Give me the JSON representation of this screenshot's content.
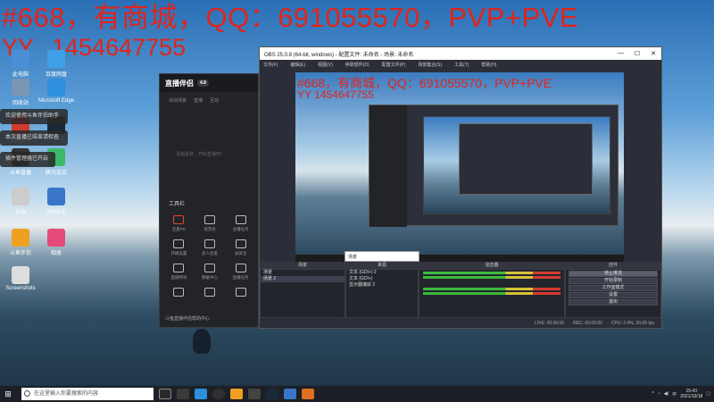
{
  "overlay": {
    "line1": "#668，有商城，QQ：691055570，PVP+PVE",
    "line2_prefix": "YY",
    "line2_number": "1454647755"
  },
  "desktop_icons": [
    {
      "label": "此电脑",
      "color": "#4a8fd8"
    },
    {
      "label": "百度网盘",
      "color": "#3fa0e8"
    },
    {
      "label": "回收站",
      "color": "#7b95b5"
    },
    {
      "label": "Microsoft Edge",
      "color": "#2e8ee0"
    },
    {
      "label": "火绒安全",
      "color": "#d03b2e"
    },
    {
      "label": "Steam",
      "color": "#1b2838"
    },
    {
      "label": "斗鱼直播",
      "color": "#333"
    },
    {
      "label": "腾讯会议",
      "color": "#3db86b"
    },
    {
      "label": "文档",
      "color": "#ccc"
    },
    {
      "label": "360安全",
      "color": "#3a76c8"
    },
    {
      "label": "斗鱼伴侣",
      "color": "#f0a020"
    },
    {
      "label": "相册",
      "color": "#e64a7a"
    },
    {
      "label": "Screenshots",
      "color": "#ddd"
    }
  ],
  "toasts": [
    "欢迎使用斗鱼伴侣助手",
    "本次直播已结束请检查",
    "插件管理器已开启"
  ],
  "zb_window": {
    "title": "直播伴侣",
    "version": "4.8",
    "tabs": [
      "添加场景",
      "直播",
      "互动"
    ],
    "hint": "添加素材，开始直播吧！",
    "tools_title": "工具栏",
    "tools": [
      "连麦PK",
      "语音房",
      "主播任务",
      "开播设置",
      "多人连麦",
      "录屏宝",
      "直播特效",
      "数据中心",
      "直播任务",
      "",
      "",
      ""
    ],
    "footer": "斗鱼直播伴侣帮助中心"
  },
  "obs": {
    "title": "OBS 25.0.8 (64-bit, windows) - 配置文件: 未命名 - 场景: 未命名",
    "menu": [
      "文件(F)",
      "编辑(E)",
      "视图(V)",
      "停靠部件(D)",
      "配置文件(P)",
      "场景集合(S)",
      "工具(T)",
      "帮助(H)"
    ],
    "panels": {
      "scenes_title": "场景",
      "scenes": [
        "场景",
        "场景 2"
      ],
      "sources_title": "来源",
      "sources": [
        "文本 (GDI+) 2",
        "文本 (GDI+)",
        "显示器捕获 2"
      ],
      "mixer_title": "混音器",
      "controls_title": "控件",
      "controls": [
        "停止推流",
        "开始录制",
        "工作室模式",
        "设置",
        "退出"
      ]
    },
    "statusbar": [
      "LIVE: 00:00:00",
      "REC: 00:00:00",
      "CPU: 2.4%, 30.00 fps"
    ]
  },
  "popup": "场景",
  "taskbar": {
    "search_placeholder": "在这里输入你要搜索的内容",
    "time": "15:43",
    "date": "2021/10/18"
  }
}
